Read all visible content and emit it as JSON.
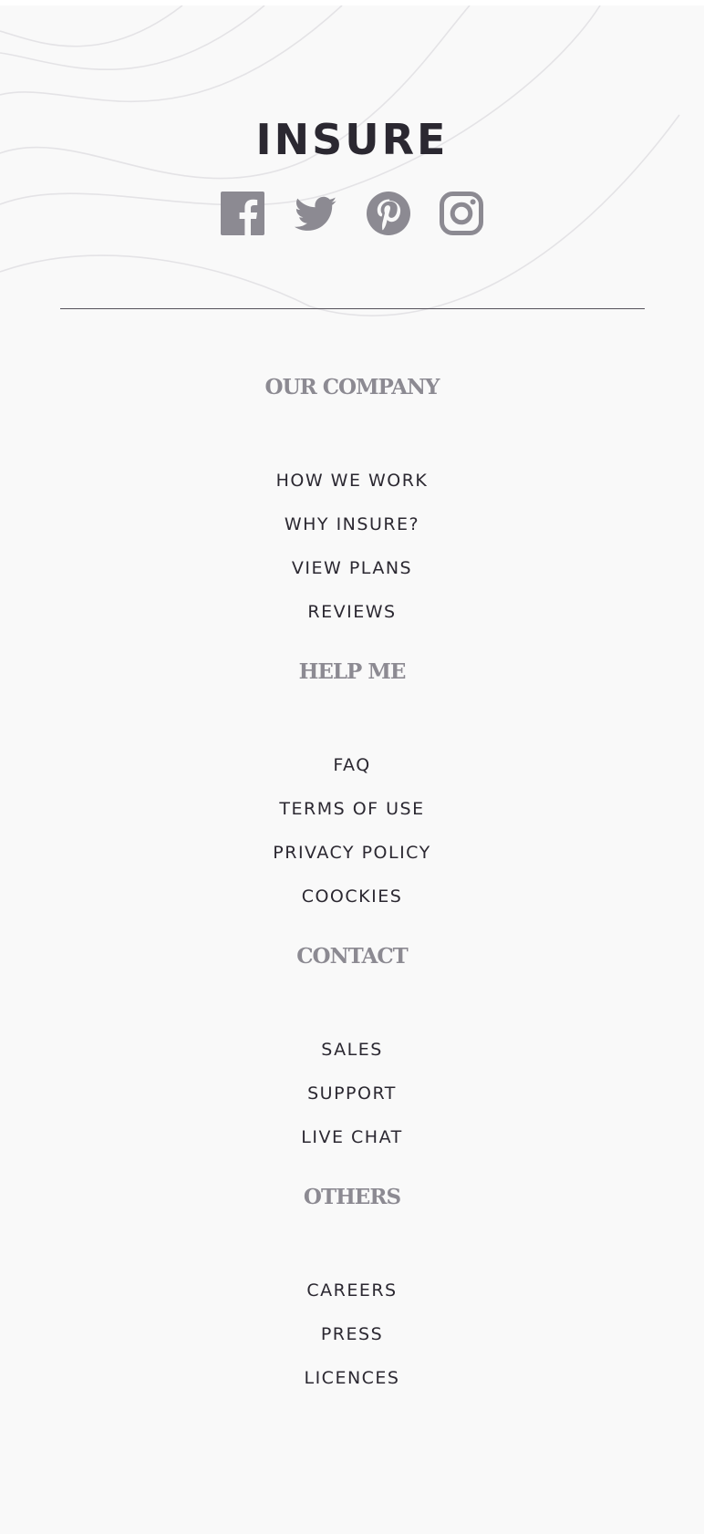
{
  "brand": {
    "logo_text": "INSURE"
  },
  "social": [
    {
      "icon": "facebook-icon",
      "label": "Facebook"
    },
    {
      "icon": "twitter-icon",
      "label": "Twitter"
    },
    {
      "icon": "pinterest-icon",
      "label": "Pinterest"
    },
    {
      "icon": "instagram-icon",
      "label": "Instagram"
    }
  ],
  "colors": {
    "background": "#f9f9f9",
    "text_dark": "#2b2831",
    "heading_gray": "#8c8a92",
    "icon_gray": "#8c8a92",
    "divider": "#55525a"
  },
  "sections": {
    "our_company": {
      "title": "OUR COMPANY",
      "links": [
        "HOW WE WORK",
        "WHY INSURE?",
        "VIEW PLANS",
        "REVIEWS"
      ]
    },
    "help_me": {
      "title": "HELP ME",
      "links": [
        "FAQ",
        "TERMS OF USE",
        "PRIVACY POLICY",
        "COOCKIES"
      ]
    },
    "contact": {
      "title": "CONTACT",
      "links": [
        "SALES",
        "SUPPORT",
        "LIVE CHAT"
      ]
    },
    "others": {
      "title": "OTHERS",
      "links": [
        "CAREERS",
        "PRESS",
        "LICENCES"
      ]
    }
  }
}
